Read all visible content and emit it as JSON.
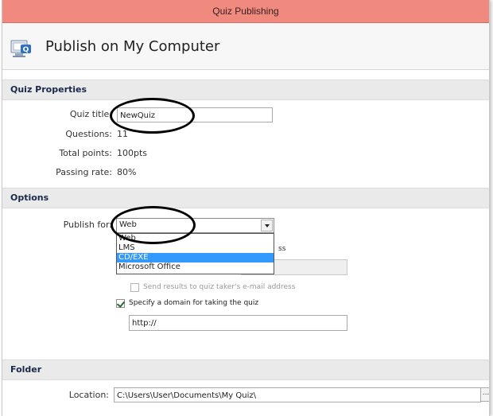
{
  "window": {
    "title": "Quiz Publishing"
  },
  "header": {
    "title": "Publish on My Computer",
    "icon": "quiz-computer-icon"
  },
  "quiz_properties": {
    "heading": "Quiz Properties",
    "title_label": "Quiz title:",
    "title_value": "NewQuiz",
    "questions_label": "Questions:",
    "questions_value": "11",
    "total_points_label": "Total points:",
    "total_points_value": "100pts",
    "passing_rate_label": "Passing rate:",
    "passing_rate_value": "80%"
  },
  "options": {
    "heading": "Options",
    "publish_for_label": "Publish for:",
    "publish_for_value": "Web",
    "dropdown_options": [
      "Web",
      "LMS",
      "CD/EXE",
      "Microsoft Office"
    ],
    "highlighted_option": "CD/EXE",
    "hidden_text_fragment": "ss",
    "send_results_label": "Send results to quiz taker's e-mail address",
    "send_results_checked": false,
    "specify_domain_label": "Specify a domain for taking the quiz",
    "specify_domain_checked": true,
    "domain_value": "http://"
  },
  "folder": {
    "heading": "Folder",
    "location_label": "Location:",
    "location_value": "C:\\Users\\User\\Documents\\My Quiz\\",
    "browse_label": "..."
  },
  "colors": {
    "titlebar": "#f08a7e",
    "highlight": "#3399ff",
    "section": "#eaeaea"
  }
}
